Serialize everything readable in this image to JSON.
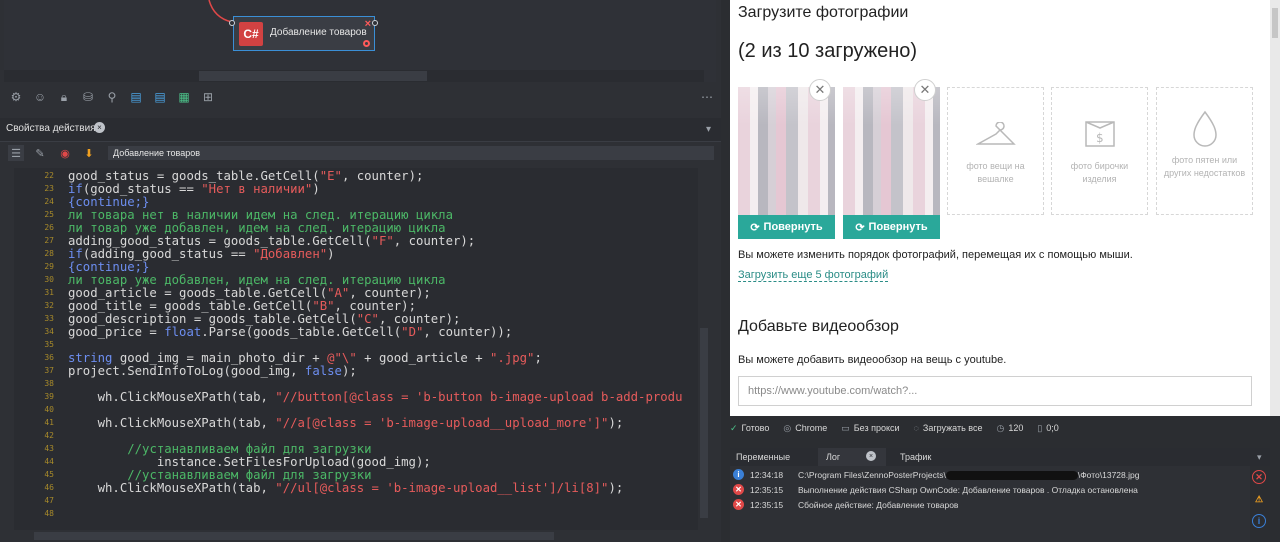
{
  "node": {
    "badge": "C#",
    "title": "Добавление товаров",
    "close": "×"
  },
  "props": {
    "tab_label": "Свойства действия",
    "tab_close": "×",
    "action_name": "Добавление товаров"
  },
  "code": {
    "line_numbers": [
      "22",
      "23",
      "24",
      "25",
      "26",
      "27",
      "28",
      "29",
      "30",
      "31",
      "32",
      "33",
      "34",
      "35",
      "36",
      "37",
      "38",
      "39",
      "40",
      "41",
      "42",
      "43",
      "44",
      "45",
      "46",
      "47",
      "48"
    ]
  },
  "browser": {
    "upload_heading": "Загрузите фотографии",
    "upload_count": "(2 из 10 загружено)",
    "rotate_label": "Повернуть",
    "slots": [
      {
        "icon": "hanger-icon",
        "label": "фото вещи на вешалке"
      },
      {
        "icon": "tag-icon",
        "label": "фото бирочки изделия"
      },
      {
        "icon": "drop-icon",
        "label": "фото пятен или других недостатков"
      }
    ],
    "reorder_text": "Вы можете изменить порядок фотографий, перемещая их с помощью мыши.",
    "upload_more": "Загрузить еще 5 фотографий",
    "video_heading": "Добавьте видеообзор",
    "video_desc": "Вы можете добавить видеообзор на вещь с youtube.",
    "video_placeholder": "https://www.youtube.com/watch?..."
  },
  "status": {
    "ready": "Готово",
    "browser": "Chrome",
    "proxy": "Без прокси",
    "load": "Загружать все",
    "timeout": "120",
    "coords": "0;0"
  },
  "log_tabs": {
    "variables": "Переменные",
    "log": "Лог",
    "traffic": "Трафик"
  },
  "log": [
    {
      "type": "info",
      "time": "12:34:18",
      "msg_a": "C:\\Program Files\\ZennoPosterProjects\\",
      "msg_b": "\\Фото\\13728.jpg"
    },
    {
      "type": "error",
      "time": "12:35:15",
      "msg": "Выполнение действия CSharp OwnCode: Добавление товаров . Отладка остановлена"
    },
    {
      "type": "error",
      "time": "12:35:15",
      "msg": "Сбойное действие: Добавление товаров"
    }
  ],
  "colors": {
    "accent": "#2aa89a",
    "node_border": "#3b8fd6",
    "error": "#e04848",
    "info": "#3a7fd6"
  }
}
